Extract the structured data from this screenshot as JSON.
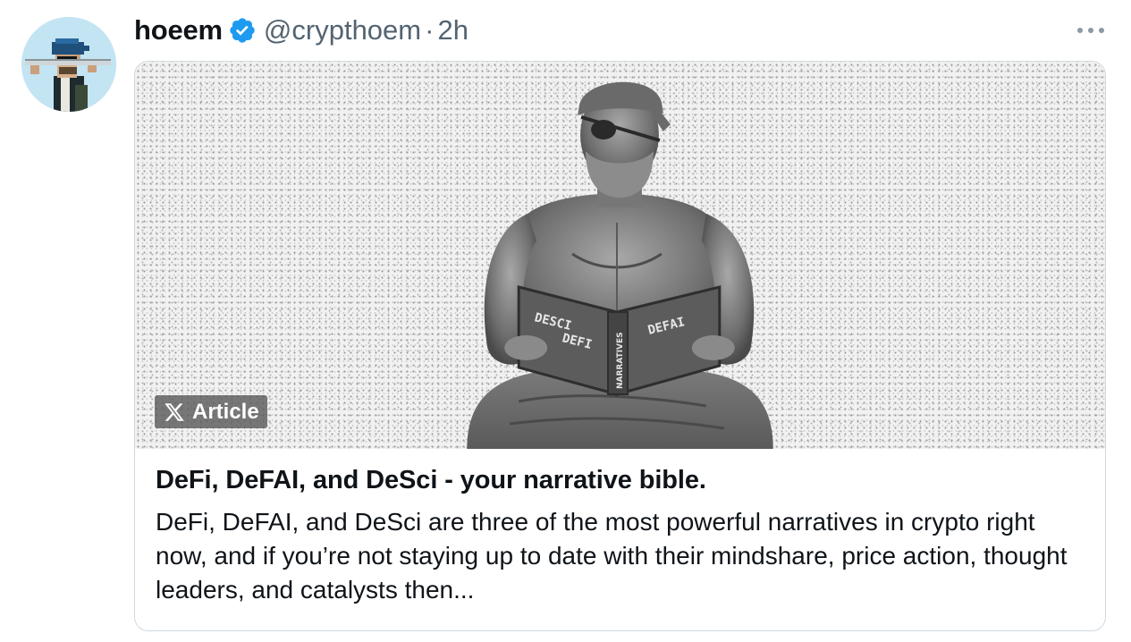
{
  "author": {
    "display_name": "hoeem",
    "handle": "@crypthoem",
    "separator": "·",
    "time": "2h",
    "verified": true,
    "avatar_icon": "pixel-art-pirate-avatar"
  },
  "menu": {
    "icon": "more-horizontal-icon"
  },
  "article": {
    "badge_label": "Article",
    "badge_icon": "x-logo-icon",
    "image_alt": "sketch of a bearded man with eyepatch and bandana reading a book",
    "book_left_text": [
      "DESCI",
      "DEFI"
    ],
    "book_right_text": "DEFAI",
    "book_spine_text": "NARRATIVES",
    "title": "DeFi, DeFAI, and DeSci - your narrative bible.",
    "description": "DeFi, DeFAI, and DeSci are three of the most powerful narratives in crypto right now, and if you’re not staying up to date with their mindshare, price action, thought leaders, and catalysts then..."
  },
  "colors": {
    "verified_blue": "#1d9bf0",
    "secondary_text": "#536471",
    "border": "#cfd9de"
  }
}
